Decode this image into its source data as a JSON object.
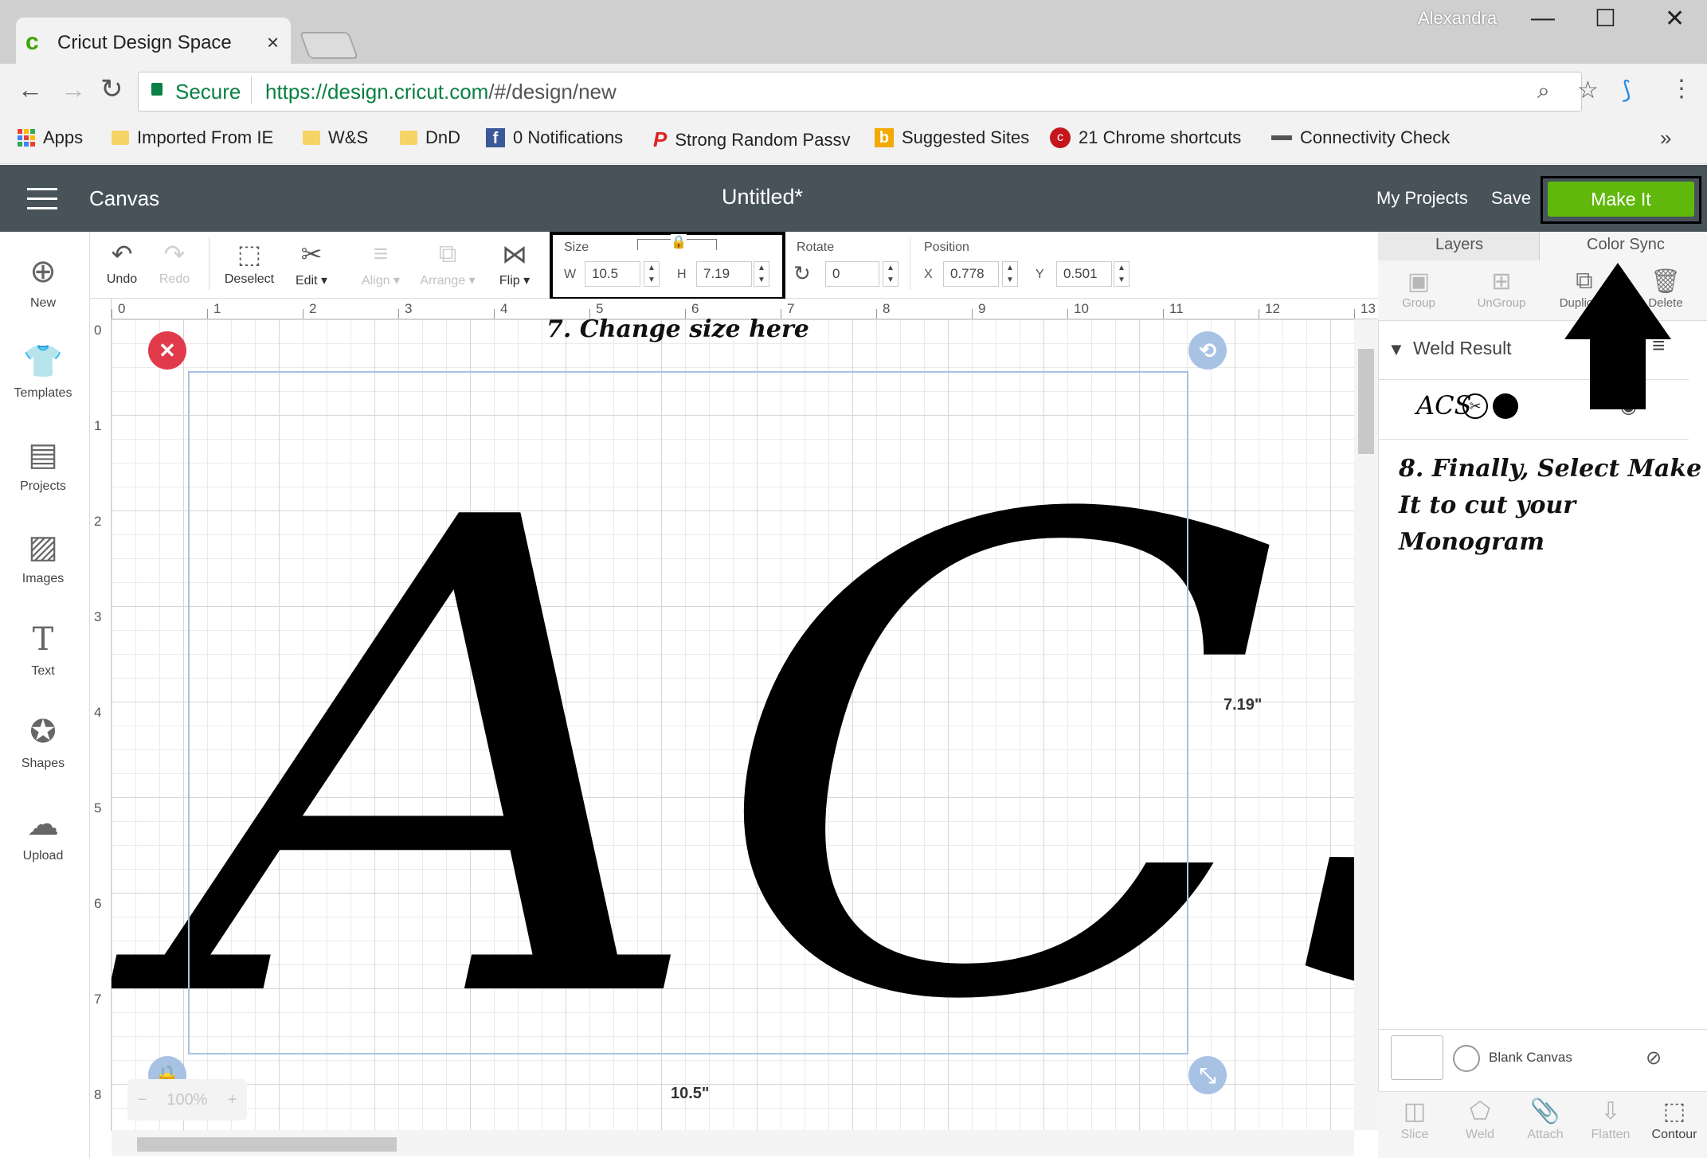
{
  "browser": {
    "tab_title": "Cricut Design Space",
    "tab_close": "×",
    "user": "Alexandra",
    "minimize": "—",
    "maximize": "☐",
    "close": "✕",
    "secure_label": "Secure",
    "url_host": "https://design.cricut.com",
    "url_path": "/#/design/new",
    "bookmarks": [
      "Apps",
      "Imported From IE",
      "W&S",
      "DnD",
      "0 Notifications",
      "Strong Random Passv",
      "Suggested Sites",
      "21 Chrome shortcuts",
      "Connectivity Check"
    ],
    "more": "»"
  },
  "header": {
    "section": "Canvas",
    "doc_title": "Untitled*",
    "my_projects": "My Projects",
    "save": "Save",
    "make_it": "Make It",
    "accent": "#5fb80b"
  },
  "left_rail": [
    "New",
    "Templates",
    "Projects",
    "Images",
    "Text",
    "Shapes",
    "Upload"
  ],
  "toolbar": {
    "undo": "Undo",
    "redo": "Redo",
    "deselect": "Deselect",
    "edit": "Edit",
    "align": "Align",
    "arrange": "Arrange",
    "flip": "Flip",
    "size_label": "Size",
    "w_label": "W",
    "w_value": "10.5",
    "h_label": "H",
    "h_value": "7.19",
    "rotate_label": "Rotate",
    "rotate_value": "0",
    "position_label": "Position",
    "x_label": "X",
    "x_value": "0.778",
    "y_label": "Y",
    "y_value": "0.501"
  },
  "canvas": {
    "ruler_top": [
      "0",
      "1",
      "2",
      "3",
      "4",
      "5",
      "6",
      "7",
      "8",
      "9",
      "10",
      "11",
      "12",
      "13"
    ],
    "ruler_left": [
      "0",
      "1",
      "2",
      "3",
      "4",
      "5",
      "6",
      "7",
      "8"
    ],
    "note_size": "7. Change size here",
    "dim_height": "7.19\"",
    "dim_width": "10.5\"",
    "zoom": "100%",
    "zoom_minus": "−",
    "zoom_plus": "+",
    "monogram": "ACS"
  },
  "right_panel": {
    "tabs": [
      "Layers",
      "Color Sync"
    ],
    "tools": [
      "Group",
      "UnGroup",
      "Duplicate",
      "Delete"
    ],
    "weld_title": "Weld Result",
    "weld_thumb": "ACS",
    "note_make": "8. Finally, Select Make It to cut your Monogram",
    "blank_canvas": "Blank Canvas",
    "bottom_tools": [
      "Slice",
      "Weld",
      "Attach",
      "Flatten",
      "Contour"
    ]
  }
}
